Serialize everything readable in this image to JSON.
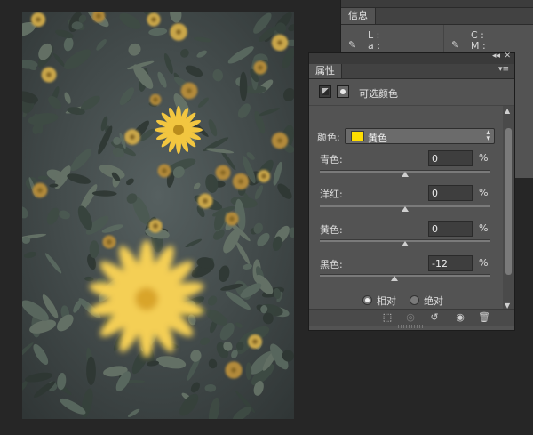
{
  "info_panel": {
    "tab_label": "信息",
    "left_channels": [
      "L :",
      "a :"
    ],
    "right_channels": [
      "C :",
      "M :"
    ]
  },
  "properties_panel": {
    "title_controls": {
      "collapse": "◂◂",
      "close": "✕"
    },
    "tab_label": "属性",
    "menu_icon": "panel-menu-icon",
    "adjustment_title": "可选颜色",
    "colors_label": "颜色:",
    "colors_selected": "黄色",
    "colors_swatch": "#ffde00",
    "sliders": [
      {
        "label": "青色:",
        "value": "0",
        "unit": "%",
        "level": 0
      },
      {
        "label": "洋红:",
        "value": "0",
        "unit": "%",
        "level": 0
      },
      {
        "label": "黄色:",
        "value": "0",
        "unit": "%",
        "level": 0
      },
      {
        "label": "黑色:",
        "value": "-12",
        "unit": "%",
        "level": -12
      }
    ],
    "method_options": [
      {
        "label": "相对",
        "checked": true
      },
      {
        "label": "绝对",
        "checked": false
      }
    ]
  },
  "colors": {
    "panel_bg": "#535353",
    "workspace_bg": "#262626",
    "accent_yellow": "#ffde00"
  }
}
